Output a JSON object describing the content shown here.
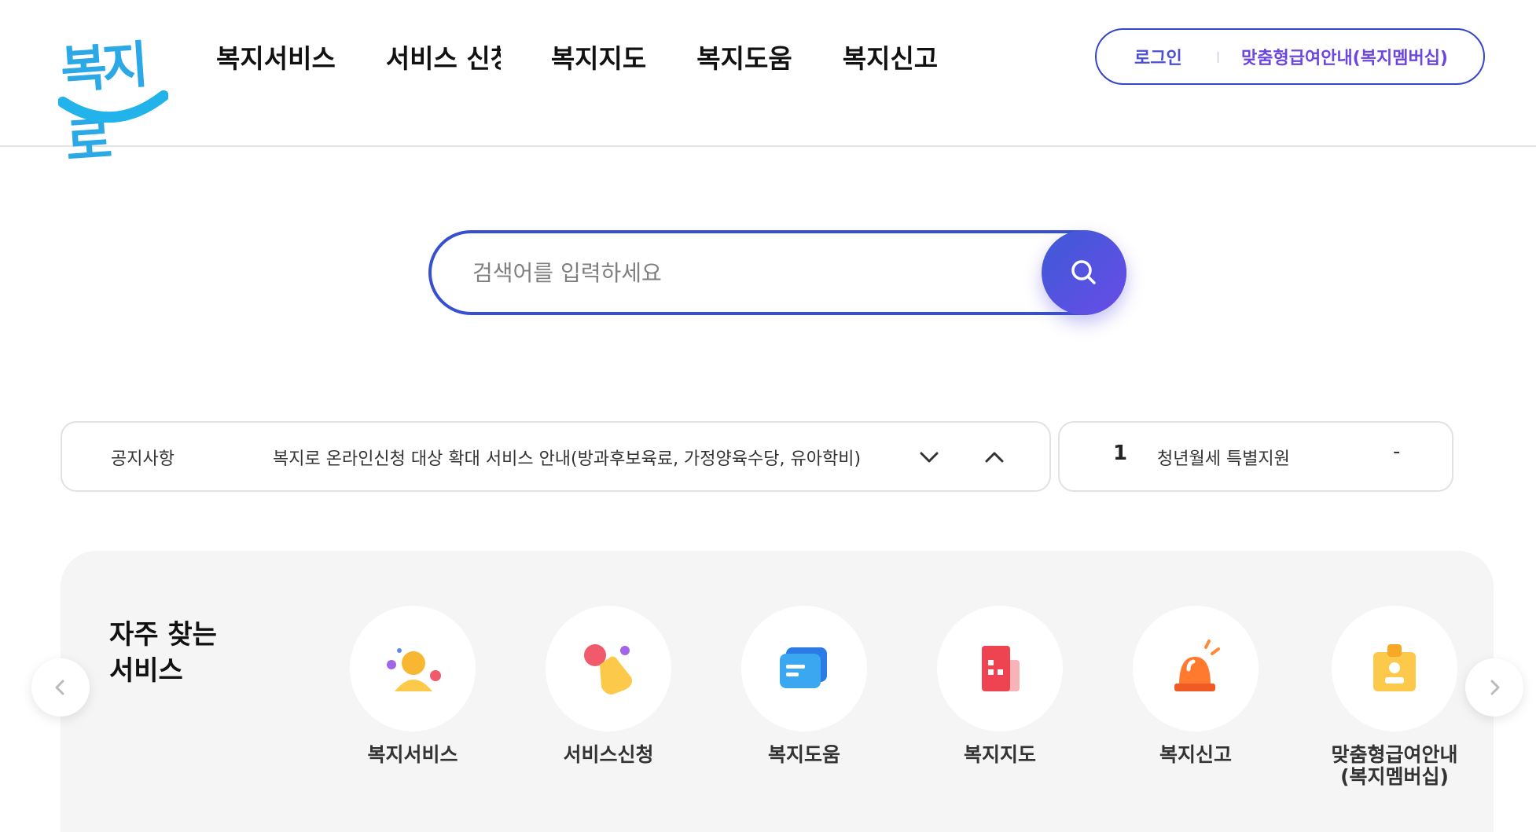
{
  "header": {
    "logo_text": "복지로",
    "nav": [
      "복지서비스",
      "서비스 신청",
      "복지지도",
      "복지도움",
      "복지신고"
    ],
    "login": "로그인",
    "member_info": "맞춤형급여안내(복지멤버십)"
  },
  "search": {
    "placeholder": "검색어를 입력하세요"
  },
  "notice": {
    "label": "공지사항",
    "text": "복지로 온라인신청 대상 확대 서비스 안내(방과후보육료, 가정양육수당, 유아학비)"
  },
  "ranking": {
    "number": "1",
    "text": "청년월세 특별지원",
    "toggle": "-"
  },
  "services": {
    "title_line1": "자주 찾는",
    "title_line2": "서비스",
    "items": [
      {
        "label": "복지서비스",
        "icon": "person-icon"
      },
      {
        "label": "서비스신청",
        "icon": "hand-pointer-icon"
      },
      {
        "label": "복지도움",
        "icon": "chat-card-icon"
      },
      {
        "label": "복지지도",
        "icon": "map-blocks-icon"
      },
      {
        "label": "복지신고",
        "icon": "siren-icon"
      },
      {
        "label": "맞춤형급여안내\n(복지멤버십)",
        "icon": "id-badge-icon"
      }
    ]
  },
  "colors": {
    "brand_blue": "#3650d0",
    "brand_purple": "#6a4ce8",
    "logo_blue": "#2aa9e6"
  }
}
